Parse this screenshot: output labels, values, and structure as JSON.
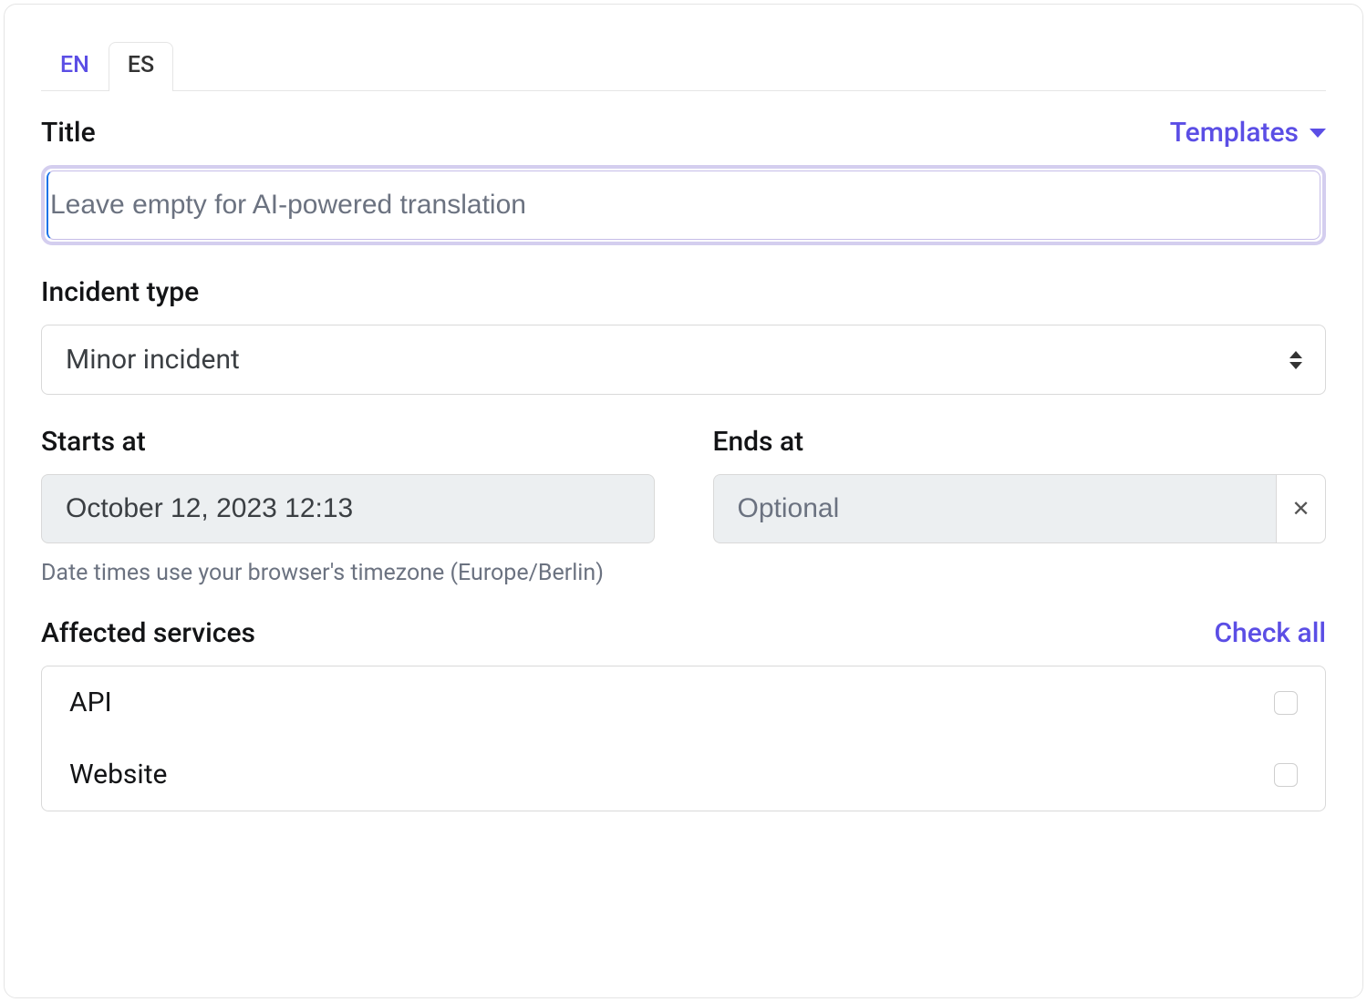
{
  "tabs": [
    {
      "label": "EN",
      "active": false
    },
    {
      "label": "ES",
      "active": true
    }
  ],
  "title": {
    "label": "Title",
    "templates_label": "Templates",
    "placeholder": "Leave empty for AI-powered translation",
    "value": ""
  },
  "incident_type": {
    "label": "Incident type",
    "selected": "Minor incident"
  },
  "dates": {
    "starts_label": "Starts at",
    "starts_value": "October 12, 2023 12:13",
    "ends_label": "Ends at",
    "ends_placeholder": "Optional",
    "ends_value": "",
    "timezone_note": "Date times use your browser's timezone (Europe/Berlin)"
  },
  "services": {
    "label": "Affected services",
    "check_all_label": "Check all",
    "items": [
      {
        "name": "API",
        "checked": false
      },
      {
        "name": "Website",
        "checked": false
      }
    ]
  },
  "icons": {
    "close": "✕"
  }
}
